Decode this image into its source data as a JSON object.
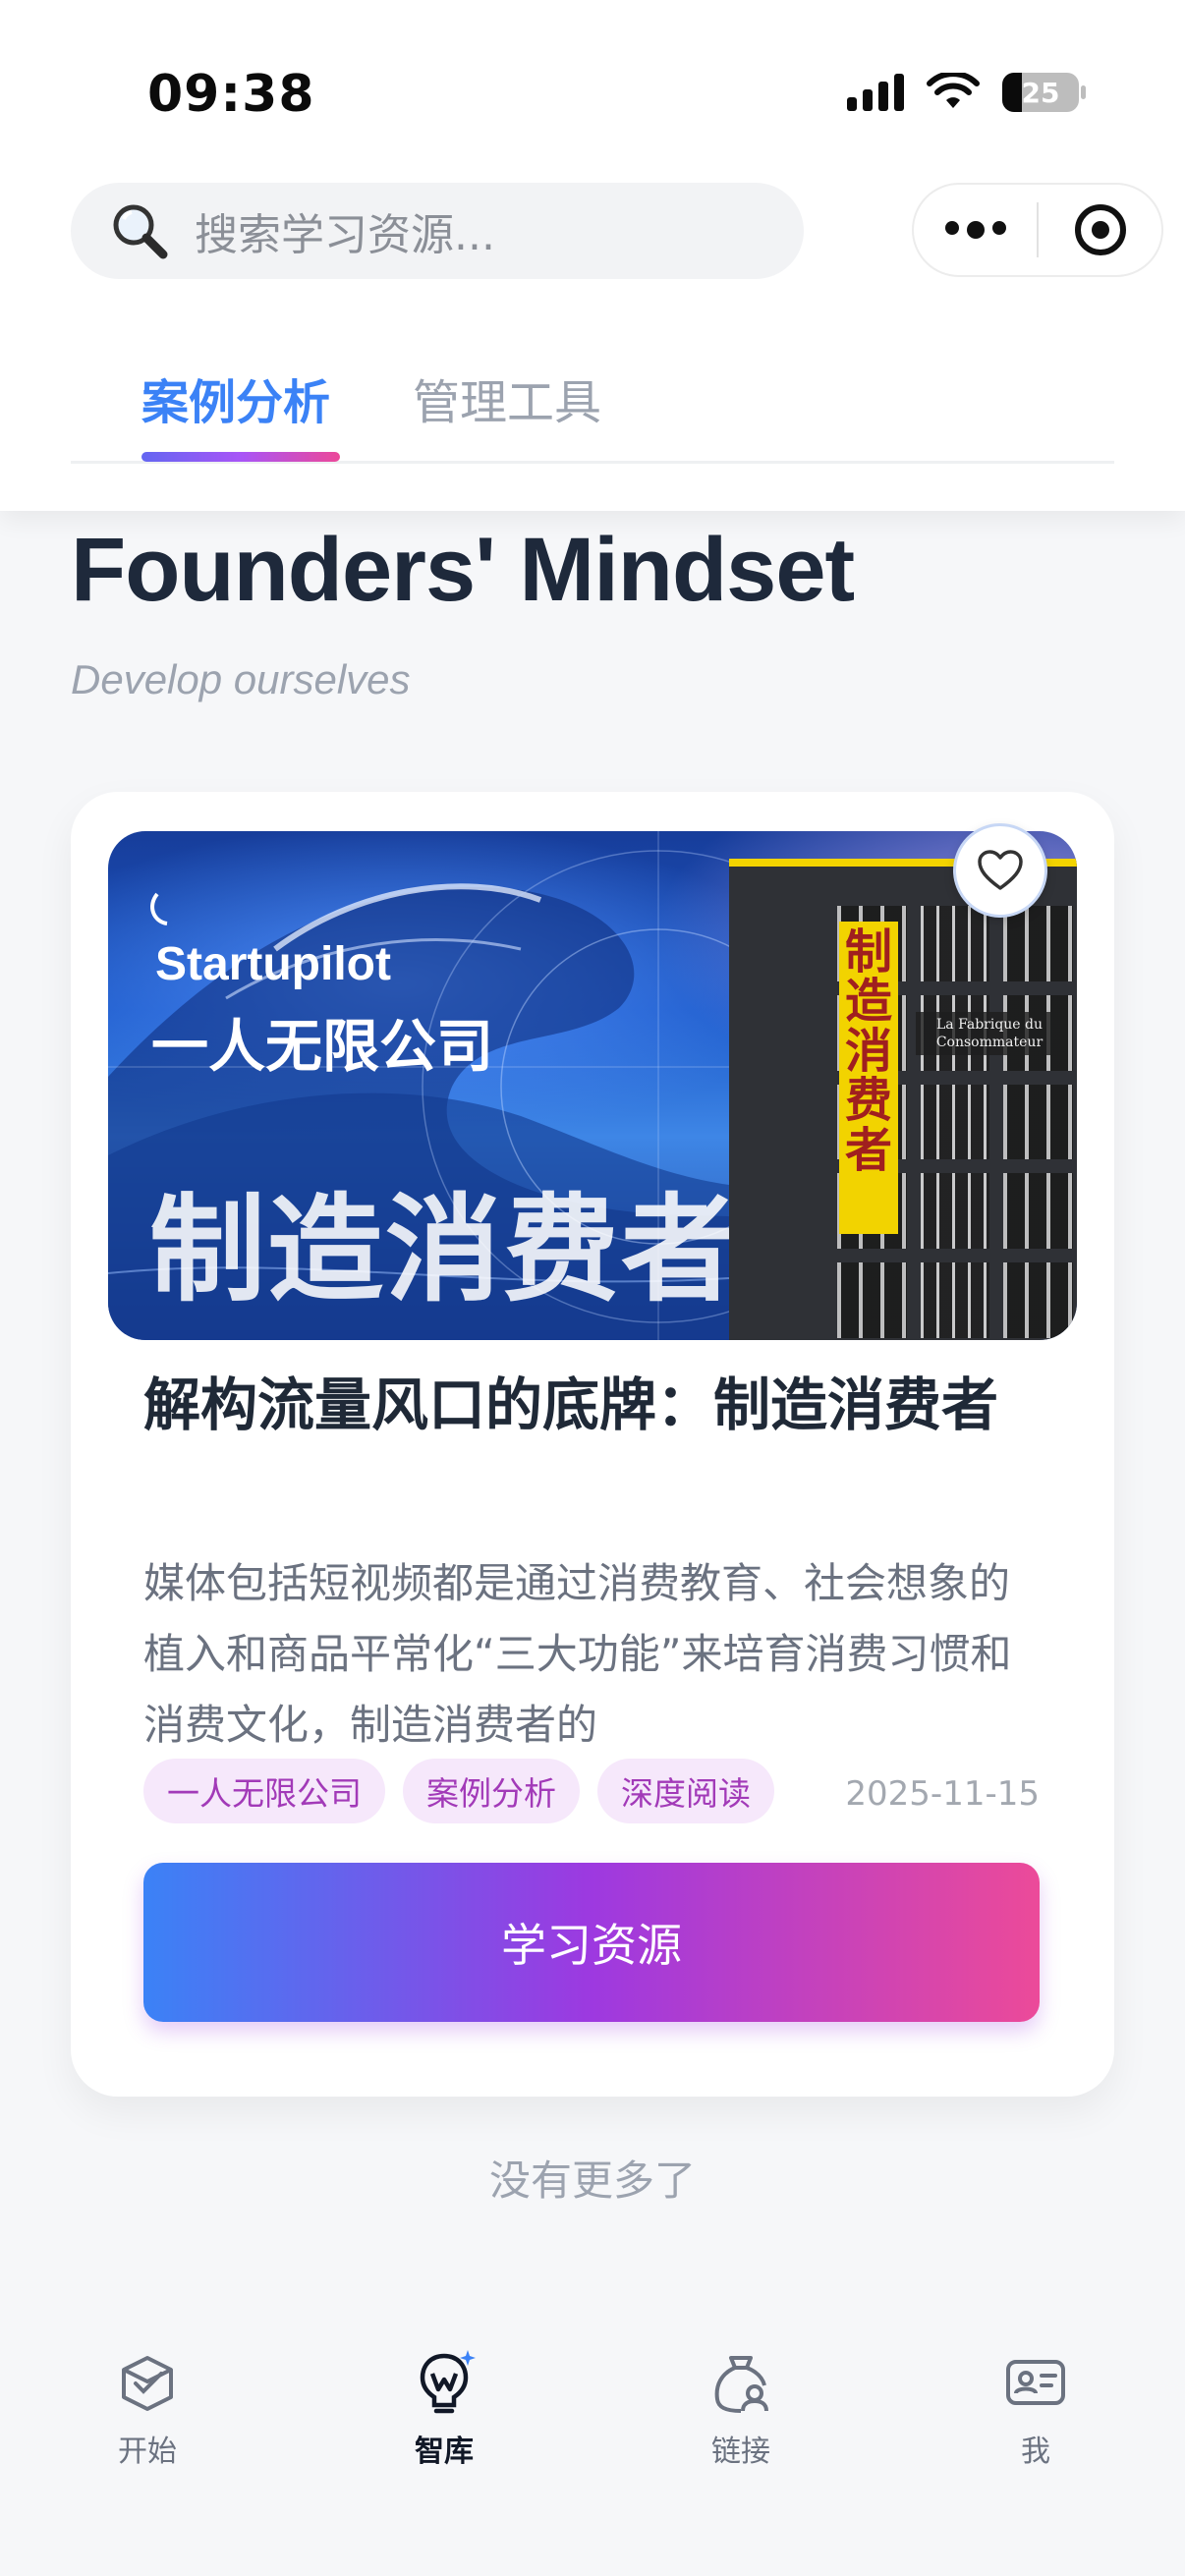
{
  "status_bar": {
    "time": "09:38",
    "battery": "25"
  },
  "search": {
    "placeholder": "搜索学习资源..."
  },
  "tabs": [
    {
      "label": "案例分析",
      "active": true
    },
    {
      "label": "管理工具",
      "active": false
    }
  ],
  "section": {
    "title": "Founders' Mindset",
    "subtitle": "Develop ourselves"
  },
  "card": {
    "cover": {
      "brand": "Startupilot",
      "company": "一人无限公司",
      "headline": "制造消费者",
      "book_title": "制造消费者",
      "book_subtitle": "La Fabrique du Consommateur"
    },
    "title": "解构流量风口的底牌：制造消费者",
    "description": "媒体包括短视频都是通过消费教育、社会想象的植入和商品平常化“三大功能”来培育消费习惯和消费文化，制造消费者的",
    "tags": [
      "一人无限公司",
      "案例分析",
      "深度阅读"
    ],
    "date": "2025-11-15",
    "cta_label": "学习资源"
  },
  "list_end": "没有更多了",
  "bottom_nav": [
    {
      "label": "开始",
      "icon": "box-check-icon",
      "active": false
    },
    {
      "label": "智库",
      "icon": "lightbulb-w-icon",
      "active": true
    },
    {
      "label": "链接",
      "icon": "bag-person-icon",
      "active": false
    },
    {
      "label": "我",
      "icon": "id-card-icon",
      "active": false
    }
  ],
  "colors": {
    "accent_blue": "#3b82f6",
    "accent_purple": "#a855f7",
    "accent_pink": "#ec4899",
    "tag_bg": "#f6e8fb",
    "tag_text": "#a23ab8"
  }
}
